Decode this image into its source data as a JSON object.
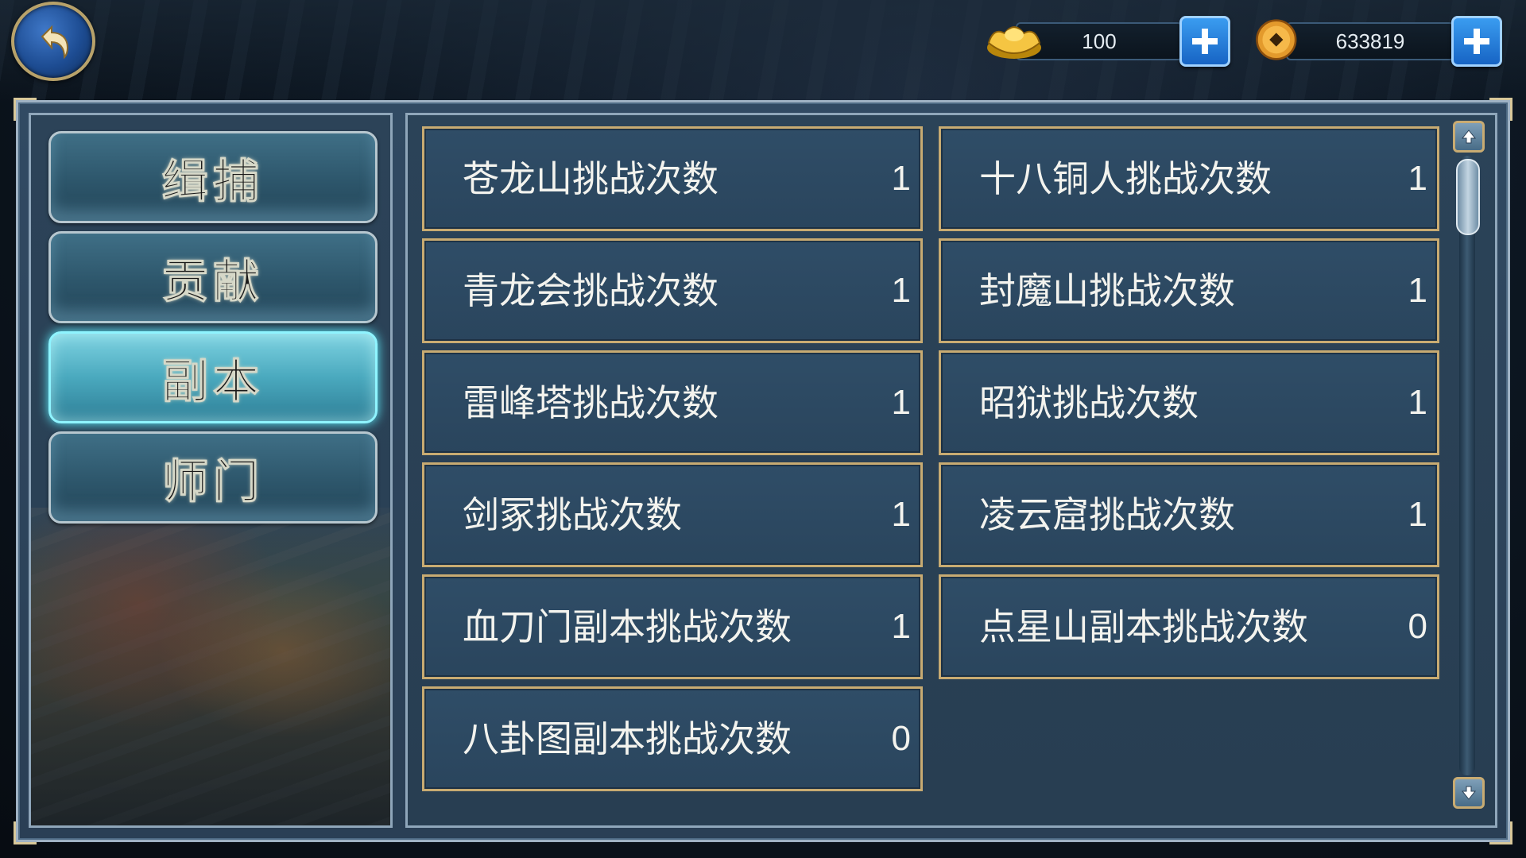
{
  "currency": {
    "gold": {
      "value": "100",
      "icon": "gold-ingot-icon"
    },
    "coin": {
      "value": "633819",
      "icon": "copper-coin-icon"
    }
  },
  "tabs": [
    {
      "label": "缉捕",
      "active": false
    },
    {
      "label": "贡献",
      "active": false
    },
    {
      "label": "副本",
      "active": true
    },
    {
      "label": "师门",
      "active": false
    }
  ],
  "entries": [
    {
      "label": "苍龙山挑战次数",
      "value": "1"
    },
    {
      "label": "十八铜人挑战次数",
      "value": "1"
    },
    {
      "label": "青龙会挑战次数",
      "value": "1"
    },
    {
      "label": "封魔山挑战次数",
      "value": "1"
    },
    {
      "label": "雷峰塔挑战次数",
      "value": "1"
    },
    {
      "label": "昭狱挑战次数",
      "value": "1"
    },
    {
      "label": "剑冢挑战次数",
      "value": "1"
    },
    {
      "label": "凌云窟挑战次数",
      "value": "1"
    },
    {
      "label": "血刀门副本挑战次数",
      "value": "1"
    },
    {
      "label": "点星山副本挑战次数",
      "value": "0"
    },
    {
      "label": "八卦图副本挑战次数",
      "value": "0"
    }
  ],
  "colors": {
    "accent_gold": "#c8ab72",
    "active_tab": "#5ef0ff",
    "plus_button": "#1764c4"
  }
}
